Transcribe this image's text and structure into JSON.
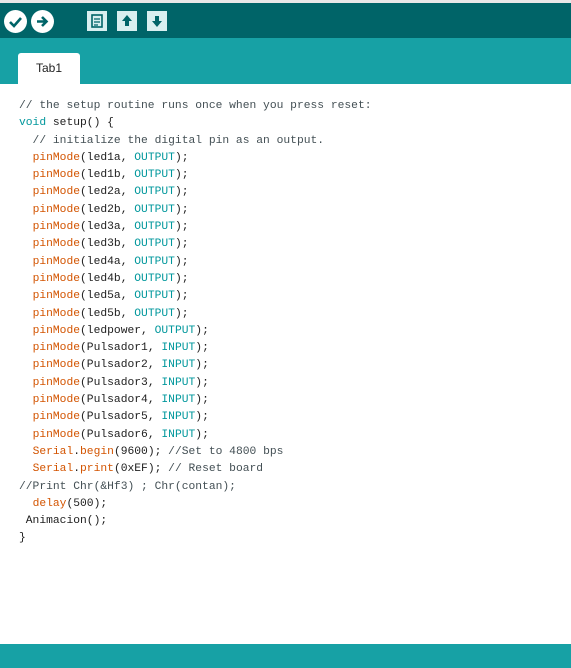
{
  "toolbar": {
    "buttons": [
      {
        "name": "verify-button",
        "icon": "check-icon"
      },
      {
        "name": "upload-button",
        "icon": "arrow-right-icon"
      },
      {
        "name": "new-button",
        "icon": "document-icon"
      },
      {
        "name": "open-button",
        "icon": "arrow-up-icon"
      },
      {
        "name": "save-button",
        "icon": "arrow-down-icon"
      }
    ]
  },
  "tabs": [
    {
      "label": "Tab1"
    }
  ],
  "editor": {
    "lines": [
      [
        {
          "t": "// the setup routine runs once when you press reset:",
          "c": "com"
        }
      ],
      [
        {
          "t": "void",
          "c": "kw"
        },
        {
          "t": " setup() {",
          "c": "plain"
        }
      ],
      [
        {
          "t": "  // initialize the digital pin as an output.",
          "c": "com"
        }
      ],
      [
        {
          "t": "  ",
          "c": "plain"
        },
        {
          "t": "pinMode",
          "c": "fn"
        },
        {
          "t": "(led1a, ",
          "c": "plain"
        },
        {
          "t": "OUTPUT",
          "c": "const"
        },
        {
          "t": ");",
          "c": "plain"
        }
      ],
      [
        {
          "t": "  ",
          "c": "plain"
        },
        {
          "t": "pinMode",
          "c": "fn"
        },
        {
          "t": "(led1b, ",
          "c": "plain"
        },
        {
          "t": "OUTPUT",
          "c": "const"
        },
        {
          "t": ");",
          "c": "plain"
        }
      ],
      [
        {
          "t": "  ",
          "c": "plain"
        },
        {
          "t": "pinMode",
          "c": "fn"
        },
        {
          "t": "(led2a, ",
          "c": "plain"
        },
        {
          "t": "OUTPUT",
          "c": "const"
        },
        {
          "t": ");",
          "c": "plain"
        }
      ],
      [
        {
          "t": "  ",
          "c": "plain"
        },
        {
          "t": "pinMode",
          "c": "fn"
        },
        {
          "t": "(led2b, ",
          "c": "plain"
        },
        {
          "t": "OUTPUT",
          "c": "const"
        },
        {
          "t": ");",
          "c": "plain"
        }
      ],
      [
        {
          "t": "  ",
          "c": "plain"
        },
        {
          "t": "pinMode",
          "c": "fn"
        },
        {
          "t": "(led3a, ",
          "c": "plain"
        },
        {
          "t": "OUTPUT",
          "c": "const"
        },
        {
          "t": ");",
          "c": "plain"
        }
      ],
      [
        {
          "t": "  ",
          "c": "plain"
        },
        {
          "t": "pinMode",
          "c": "fn"
        },
        {
          "t": "(led3b, ",
          "c": "plain"
        },
        {
          "t": "OUTPUT",
          "c": "const"
        },
        {
          "t": ");",
          "c": "plain"
        }
      ],
      [
        {
          "t": "  ",
          "c": "plain"
        },
        {
          "t": "pinMode",
          "c": "fn"
        },
        {
          "t": "(led4a, ",
          "c": "plain"
        },
        {
          "t": "OUTPUT",
          "c": "const"
        },
        {
          "t": ");",
          "c": "plain"
        }
      ],
      [
        {
          "t": "  ",
          "c": "plain"
        },
        {
          "t": "pinMode",
          "c": "fn"
        },
        {
          "t": "(led4b, ",
          "c": "plain"
        },
        {
          "t": "OUTPUT",
          "c": "const"
        },
        {
          "t": ");",
          "c": "plain"
        }
      ],
      [
        {
          "t": "  ",
          "c": "plain"
        },
        {
          "t": "pinMode",
          "c": "fn"
        },
        {
          "t": "(led5a, ",
          "c": "plain"
        },
        {
          "t": "OUTPUT",
          "c": "const"
        },
        {
          "t": ");",
          "c": "plain"
        }
      ],
      [
        {
          "t": "  ",
          "c": "plain"
        },
        {
          "t": "pinMode",
          "c": "fn"
        },
        {
          "t": "(led5b, ",
          "c": "plain"
        },
        {
          "t": "OUTPUT",
          "c": "const"
        },
        {
          "t": ");",
          "c": "plain"
        }
      ],
      [
        {
          "t": "  ",
          "c": "plain"
        },
        {
          "t": "pinMode",
          "c": "fn"
        },
        {
          "t": "(ledpower, ",
          "c": "plain"
        },
        {
          "t": "OUTPUT",
          "c": "const"
        },
        {
          "t": ");",
          "c": "plain"
        }
      ],
      [
        {
          "t": "  ",
          "c": "plain"
        },
        {
          "t": "pinMode",
          "c": "fn"
        },
        {
          "t": "(Pulsador1, ",
          "c": "plain"
        },
        {
          "t": "INPUT",
          "c": "const"
        },
        {
          "t": ");",
          "c": "plain"
        }
      ],
      [
        {
          "t": "  ",
          "c": "plain"
        },
        {
          "t": "pinMode",
          "c": "fn"
        },
        {
          "t": "(Pulsador2, ",
          "c": "plain"
        },
        {
          "t": "INPUT",
          "c": "const"
        },
        {
          "t": ");",
          "c": "plain"
        }
      ],
      [
        {
          "t": "  ",
          "c": "plain"
        },
        {
          "t": "pinMode",
          "c": "fn"
        },
        {
          "t": "(Pulsador3, ",
          "c": "plain"
        },
        {
          "t": "INPUT",
          "c": "const"
        },
        {
          "t": ");",
          "c": "plain"
        }
      ],
      [
        {
          "t": "  ",
          "c": "plain"
        },
        {
          "t": "pinMode",
          "c": "fn"
        },
        {
          "t": "(Pulsador4, ",
          "c": "plain"
        },
        {
          "t": "INPUT",
          "c": "const"
        },
        {
          "t": ");",
          "c": "plain"
        }
      ],
      [
        {
          "t": "  ",
          "c": "plain"
        },
        {
          "t": "pinMode",
          "c": "fn"
        },
        {
          "t": "(Pulsador5, ",
          "c": "plain"
        },
        {
          "t": "INPUT",
          "c": "const"
        },
        {
          "t": ");",
          "c": "plain"
        }
      ],
      [
        {
          "t": "  ",
          "c": "plain"
        },
        {
          "t": "pinMode",
          "c": "fn"
        },
        {
          "t": "(Pulsador6, ",
          "c": "plain"
        },
        {
          "t": "INPUT",
          "c": "const"
        },
        {
          "t": ");",
          "c": "plain"
        }
      ],
      [
        {
          "t": "  ",
          "c": "plain"
        },
        {
          "t": "Serial",
          "c": "fn"
        },
        {
          "t": ".",
          "c": "plain"
        },
        {
          "t": "begin",
          "c": "fn"
        },
        {
          "t": "(9600); ",
          "c": "plain"
        },
        {
          "t": "//Set to 4800 bps",
          "c": "com"
        }
      ],
      [
        {
          "t": "  ",
          "c": "plain"
        },
        {
          "t": "Serial",
          "c": "fn"
        },
        {
          "t": ".",
          "c": "plain"
        },
        {
          "t": "print",
          "c": "fn"
        },
        {
          "t": "(0xEF); ",
          "c": "plain"
        },
        {
          "t": "// Reset board",
          "c": "com"
        }
      ],
      [
        {
          "t": "//Print Chr(&Hf3) ; Chr(contan);",
          "c": "com"
        }
      ],
      [
        {
          "t": "  ",
          "c": "plain"
        },
        {
          "t": "delay",
          "c": "fn"
        },
        {
          "t": "(500);",
          "c": "plain"
        }
      ],
      [
        {
          "t": " Animacion();",
          "c": "plain"
        }
      ],
      [
        {
          "t": "}",
          "c": "plain"
        }
      ]
    ]
  },
  "colors": {
    "toolbar_bg": "#006468",
    "tabbar_bg": "#17a1a5",
    "statusbar_bg": "#17a1a5",
    "function": "#d35400",
    "keyword": "#00979c",
    "comment": "#434f54"
  }
}
